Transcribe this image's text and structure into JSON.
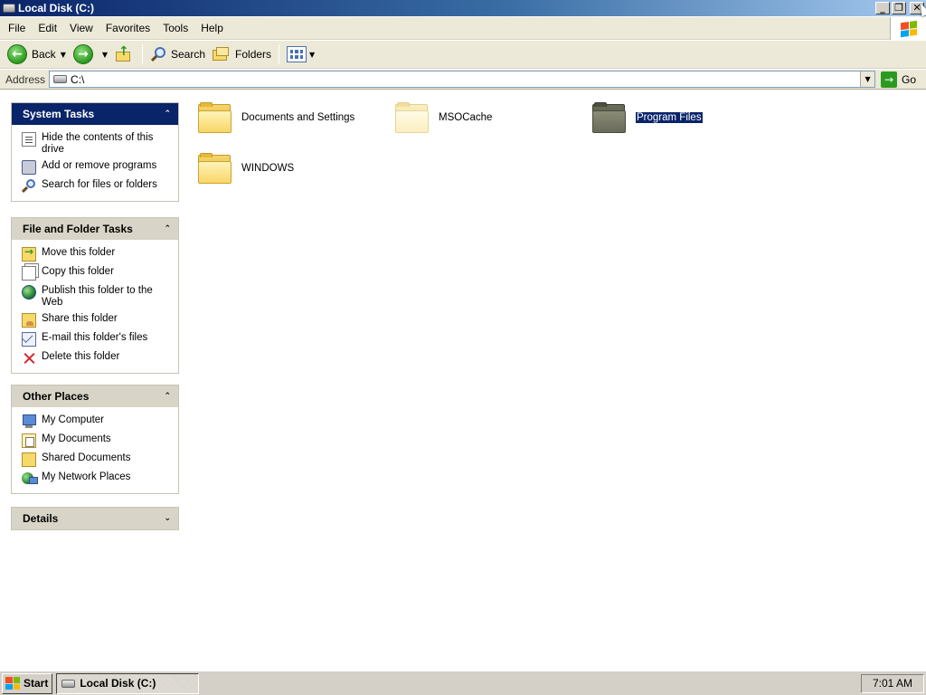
{
  "window": {
    "title": "Local Disk (C:)",
    "controls": {
      "minimize": "_",
      "restore": "❐",
      "close": "✕"
    }
  },
  "menubar": {
    "items": [
      "File",
      "Edit",
      "View",
      "Favorites",
      "Tools",
      "Help"
    ]
  },
  "toolbar": {
    "back_label": "Back",
    "search_label": "Search",
    "folders_label": "Folders"
  },
  "address": {
    "label": "Address",
    "value": "C:\\",
    "go_label": "Go"
  },
  "system_tasks": {
    "title": "System Tasks",
    "items": [
      "Hide the contents of this drive",
      "Add or remove programs",
      "Search for files or folders"
    ]
  },
  "file_folder_tasks": {
    "title": "File and Folder Tasks",
    "items": [
      "Move this folder",
      "Copy this folder",
      "Publish this folder to the Web",
      "Share this folder",
      "E-mail this folder's files",
      "Delete this folder"
    ]
  },
  "other_places": {
    "title": "Other Places",
    "items": [
      "My Computer",
      "My Documents",
      "Shared Documents",
      "My Network Places"
    ]
  },
  "details": {
    "title": "Details"
  },
  "content": {
    "items": [
      {
        "name": "Documents and Settings",
        "state": "normal"
      },
      {
        "name": "MSOCache",
        "state": "hidden"
      },
      {
        "name": "Program Files",
        "state": "selected"
      },
      {
        "name": "WINDOWS",
        "state": "normal"
      }
    ]
  },
  "taskbar": {
    "start_label": "Start",
    "window_button": "Local Disk (C:)",
    "clock": "7:01 AM"
  },
  "icons": {
    "title": "drive-icon",
    "back": "back-arrow-icon",
    "forward": "forward-arrow-icon",
    "up": "folder-up-icon",
    "search": "search-icon",
    "folders": "folders-icon",
    "views": "views-icon",
    "go": "go-arrow-icon"
  },
  "colors": {
    "title_gradient_start": "#0a246a",
    "selection": "#0a246a",
    "pane_header_grey": "#d8d5c8",
    "chrome": "#ece9d8"
  }
}
